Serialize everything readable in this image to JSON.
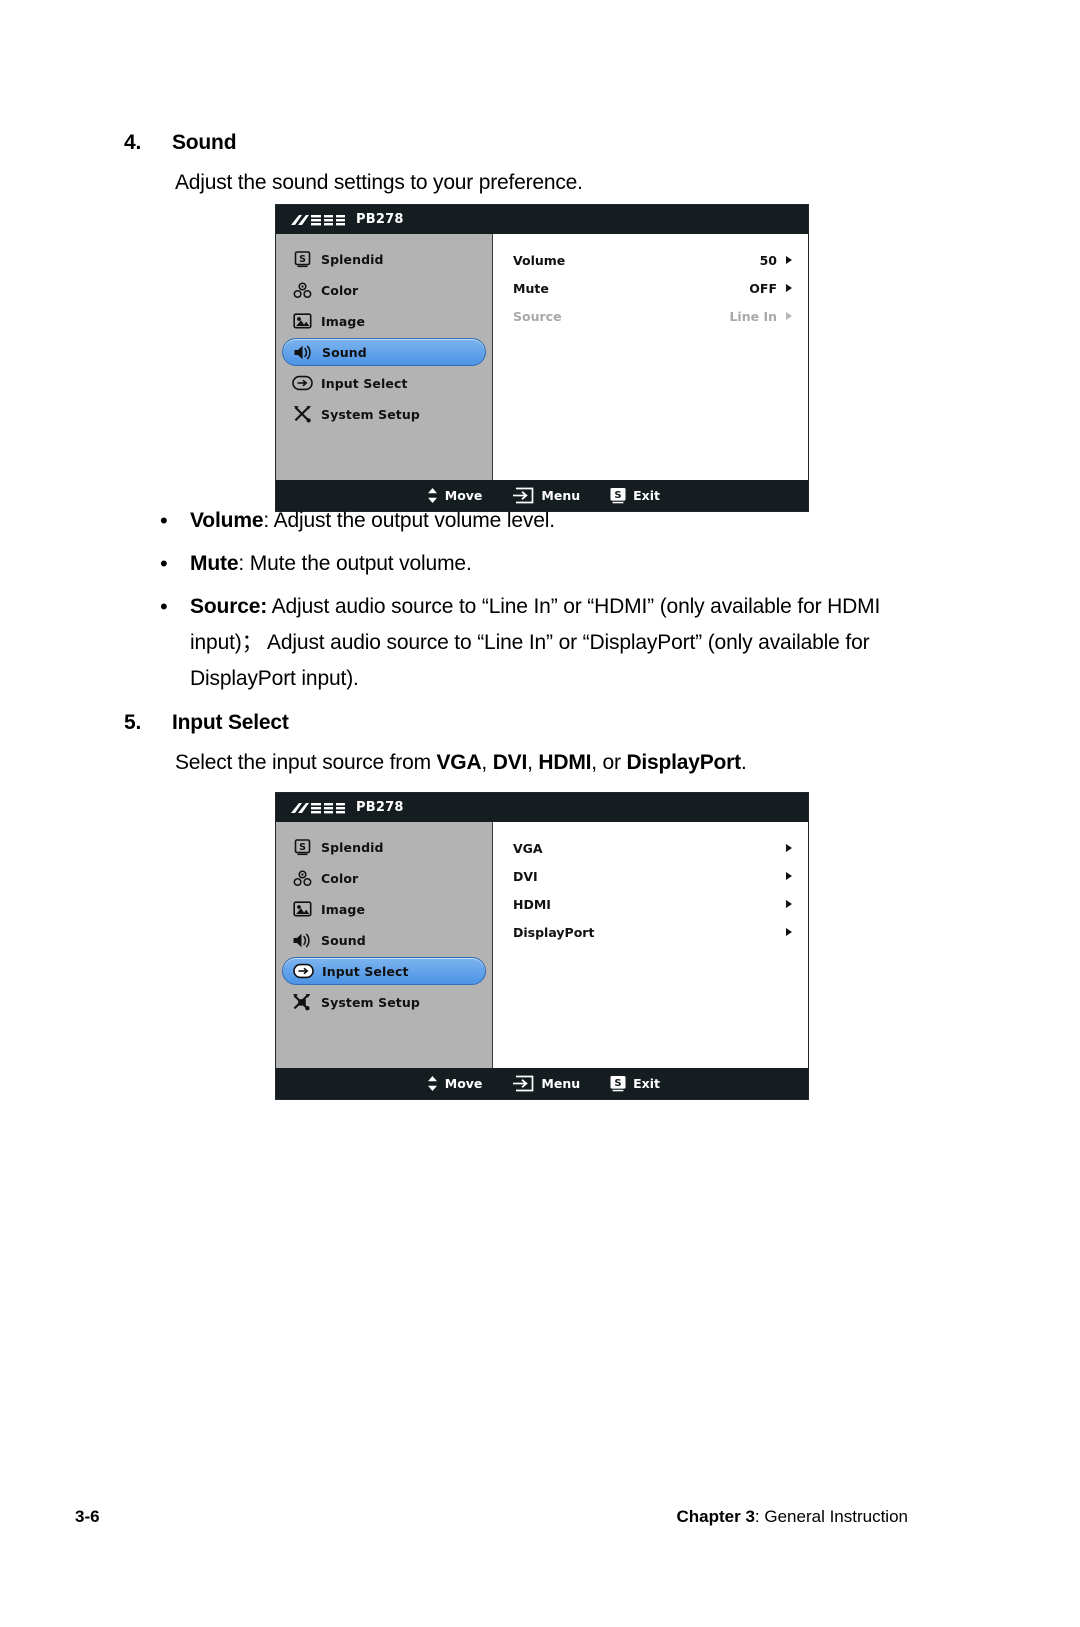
{
  "sections": [
    {
      "number": "4.",
      "title": "Sound",
      "intro": "Adjust the sound settings to your preference."
    },
    {
      "number": "5.",
      "title": "Input Select",
      "intro_prefix": "Select the input source from ",
      "intro_items": [
        "VGA",
        "DVI",
        "HDMI"
      ],
      "intro_mid": ", or ",
      "intro_last": "DisplayPort",
      "intro_suffix": "."
    }
  ],
  "bullets": [
    {
      "marker": "•",
      "term": "Volume",
      "sep": ": ",
      "text": "Adjust the output volume level."
    },
    {
      "marker": "•",
      "term": "Mute",
      "sep": ": ",
      "text": "Mute the output volume."
    },
    {
      "marker": "•",
      "term": "Source:",
      "sep": " ",
      "text": "Adjust audio source to “Line In” or “HDMI”  (only available for HDMI input)；",
      "text2": "Adjust audio source to “Line In” or “DisplayPort” (only available for DisplayPort input)."
    }
  ],
  "osd_sound": {
    "brand": "/SUS",
    "model": "PB278",
    "sidebar": [
      {
        "label": "Splendid",
        "icon": "splendid-icon",
        "selected": false
      },
      {
        "label": "Color",
        "icon": "color-icon",
        "selected": false
      },
      {
        "label": "Image",
        "icon": "image-icon",
        "selected": false
      },
      {
        "label": "Sound",
        "icon": "sound-icon",
        "selected": true
      },
      {
        "label": "Input Select",
        "icon": "input-select-icon",
        "selected": false
      },
      {
        "label": "System Setup",
        "icon": "system-setup-icon",
        "selected": false
      }
    ],
    "rows": [
      {
        "key": "Volume",
        "value": "50",
        "dim": false
      },
      {
        "key": "Mute",
        "value": "OFF",
        "dim": false
      },
      {
        "key": "Source",
        "value": "Line In",
        "dim": true
      }
    ],
    "footer": [
      {
        "label": "Move",
        "icon": "updown-arrows-icon"
      },
      {
        "label": "Menu",
        "icon": "menu-enter-icon"
      },
      {
        "label": "Exit",
        "icon": "splendid-exit-icon"
      }
    ]
  },
  "osd_input": {
    "brand": "/SUS",
    "model": "PB278",
    "sidebar": [
      {
        "label": "Splendid",
        "icon": "splendid-icon",
        "selected": false
      },
      {
        "label": "Color",
        "icon": "color-icon",
        "selected": false
      },
      {
        "label": "Image",
        "icon": "image-icon",
        "selected": false
      },
      {
        "label": "Sound",
        "icon": "sound-icon",
        "selected": false
      },
      {
        "label": "Input Select",
        "icon": "input-select-icon",
        "selected": true
      },
      {
        "label": "System Setup",
        "icon": "system-setup-icon",
        "selected": false
      }
    ],
    "rows": [
      {
        "key": "VGA",
        "value": "",
        "dim": false
      },
      {
        "key": "DVI",
        "value": "",
        "dim": false
      },
      {
        "key": "HDMI",
        "value": "",
        "dim": false
      },
      {
        "key": "DisplayPort",
        "value": "",
        "dim": false
      }
    ],
    "footer": [
      {
        "label": "Move",
        "icon": "updown-arrows-icon"
      },
      {
        "label": "Menu",
        "icon": "menu-enter-icon"
      },
      {
        "label": "Exit",
        "icon": "splendid-exit-icon"
      }
    ]
  },
  "page_footer": {
    "page_number": "3-6",
    "chapter_bold": "Chapter 3",
    "chapter_rest": ": General Instruction"
  }
}
